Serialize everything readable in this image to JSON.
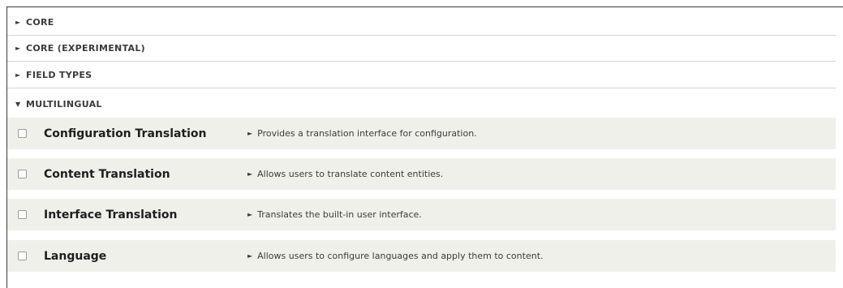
{
  "groups": [
    {
      "label": "CORE",
      "expanded": false
    },
    {
      "label": "CORE (EXPERIMENTAL)",
      "expanded": false
    },
    {
      "label": "FIELD TYPES",
      "expanded": false
    },
    {
      "label": "MULTILINGUAL",
      "expanded": true
    }
  ],
  "icons": {
    "collapsed": "►",
    "expanded": "▼"
  },
  "modules": [
    {
      "name": "Configuration Translation",
      "description": "Provides a translation interface for configuration.",
      "checked": false
    },
    {
      "name": "Content Translation",
      "description": "Allows users to translate content entities.",
      "checked": false
    },
    {
      "name": "Interface Translation",
      "description": "Translates the built-in user interface.",
      "checked": false
    },
    {
      "name": "Language",
      "description": "Allows users to configure languages and apply them to content.",
      "checked": false
    }
  ],
  "colors": {
    "row_background": "#f0f0eb",
    "divider": "#d4d4d0"
  }
}
